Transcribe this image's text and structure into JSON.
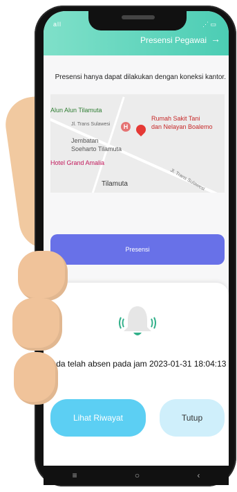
{
  "status_bar": {
    "signal_text": "all",
    "right_text": ""
  },
  "header": {
    "title": "Presensi Pegawai",
    "back_icon": "arrow-icon"
  },
  "info_text": "Presensi hanya dapat dilakukan dengan koneksi kantor.",
  "map": {
    "labels": {
      "alun": "Alun Alun Tilamuta",
      "rumah_sakit_1": "Rumah Sakit Tani",
      "rumah_sakit_2": "dan Nelayan Boalemo",
      "jembatan_1": "Jembatan",
      "jembatan_2": "Soeharto Tilamuta",
      "hotel": "Hotel Grand Amalia",
      "jalan1": "Jl. Trans Sulawesi",
      "jalan2": "Jl. Trans Sulawesi",
      "tilamuta": "Tilamuta"
    }
  },
  "presensi_button": "Presensi",
  "dialog": {
    "message": "Anda telah absen pada jam 2023-01-31 18:04:13",
    "riwayat_button": "Lihat Riwayat",
    "tutup_button": "Tutup"
  },
  "navbar": {
    "menu": "≡",
    "home": "○",
    "back": "‹"
  },
  "colors": {
    "header": "#4ccdb4",
    "presensi": "#6871e8",
    "riwayat": "#5ccff3",
    "tutup": "#cfeffb"
  }
}
